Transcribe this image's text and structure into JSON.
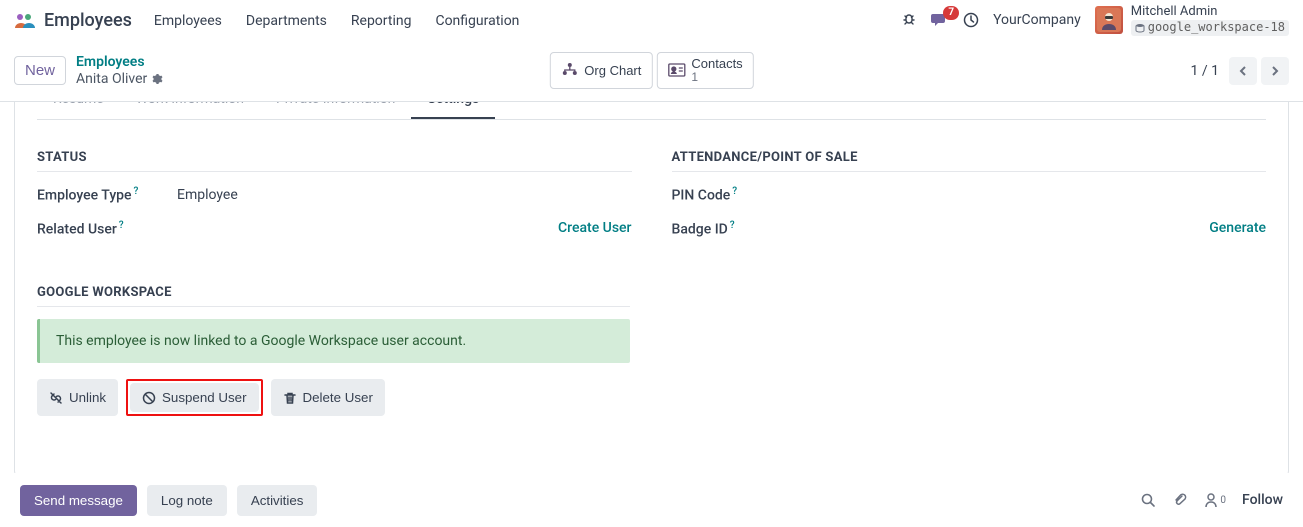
{
  "nav": {
    "app_title": "Employees",
    "links": [
      "Employees",
      "Departments",
      "Reporting",
      "Configuration"
    ],
    "chat_badge": "7",
    "company": "YourCompany",
    "user_name": "Mitchell Admin",
    "db_name": "google_workspace-18"
  },
  "control": {
    "new_label": "New",
    "breadcrumb_parent": "Employees",
    "breadcrumb_current": "Anita Oliver",
    "org_chart": "Org Chart",
    "contacts_label": "Contacts",
    "contacts_count": "1",
    "pager": "1 / 1"
  },
  "tabs": [
    "Resume",
    "Work Information",
    "Private Information",
    "Settings"
  ],
  "status": {
    "section": "STATUS",
    "employee_type_label": "Employee Type",
    "employee_type_value": "Employee",
    "related_user_label": "Related User",
    "create_user": "Create User"
  },
  "attendance": {
    "section": "ATTENDANCE/POINT OF SALE",
    "pin_label": "PIN Code",
    "badge_label": "Badge ID",
    "generate": "Generate"
  },
  "gw": {
    "section": "GOOGLE WORKSPACE",
    "alert": "This employee is now linked to a Google Workspace user account.",
    "unlink": "Unlink",
    "suspend": "Suspend User",
    "delete": "Delete User"
  },
  "chatter": {
    "send": "Send message",
    "log": "Log note",
    "activities": "Activities",
    "follow": "Follow",
    "follower_count": "0"
  }
}
